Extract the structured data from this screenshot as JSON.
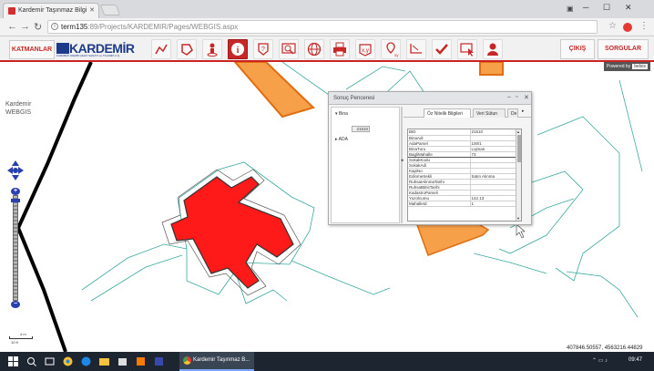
{
  "browser": {
    "tab_title": "Kardemir Taşınmaz Bilgi",
    "url_host": "term135",
    "url_path": ":89/Projects/KARDEMIR/Pages/WEBGIS.aspx"
  },
  "toolbar": {
    "katmanlar_label": "KATMANLAR",
    "logo_text": "KARDEMİR",
    "logo_subtext": "KARABÜK DEMİR ÇELİK SANAYİ ve TİCARET A.Ş.",
    "cikis_label": "ÇIKIŞ",
    "sorgular_label": "SORGULAR",
    "tools": [
      "measure-line",
      "polygon",
      "person-pin",
      "info",
      "help-shape",
      "zoom-rectangle",
      "globe",
      "print",
      "coordinate-xy",
      "location-xy",
      "line-measure",
      "check-tool",
      "select-cursor",
      "user"
    ],
    "accent_color": "#c62828"
  },
  "map": {
    "app_title_line1": "Kardemir",
    "app_title_line2": "WEBGIS",
    "powered_by": "Powered by",
    "powered_brand": "belsis",
    "coordinates": "407846.50557, 4563216.44829",
    "scale_top": "4 m",
    "scale_bottom": "10 ft",
    "building_fill": "#ff1a1a",
    "parcel_fill": "#f7a04a"
  },
  "results": {
    "title": "Sonuç Penceresi",
    "tree": {
      "node1": "Bina",
      "node1_leaf": "21510",
      "node2": "ADA"
    },
    "tabs": [
      "Öz Nitelik Bilgileri",
      "Veri Sütun",
      "De"
    ],
    "rows": [
      {
        "k": "BID",
        "v": "21510"
      },
      {
        "k": "BinaAdi",
        "v": ""
      },
      {
        "k": "AdaParsel",
        "v": "100/1"
      },
      {
        "k": "BinaTuru",
        "v": "Lojman"
      },
      {
        "k": "BagliMahalle",
        "v": "73"
      },
      {
        "k": "SokakKodu",
        "v": ""
      },
      {
        "k": "SokakAdi",
        "v": ""
      },
      {
        "k": "KapiNo",
        "v": ""
      },
      {
        "k": "EdinmeSekli",
        "v": "Satın Alınma"
      },
      {
        "k": "RuhsatAlinmaTarihi",
        "v": ""
      },
      {
        "k": "RuhsatBitisTarihi",
        "v": ""
      },
      {
        "k": "KadastroParseli",
        "v": ""
      },
      {
        "k": "Yuzolcumu",
        "v": "142.13"
      },
      {
        "k": "MahalleId",
        "v": "1"
      }
    ]
  },
  "taskbar": {
    "app_label": "Kardemir Taşınmaz B...",
    "time": "09:47"
  }
}
